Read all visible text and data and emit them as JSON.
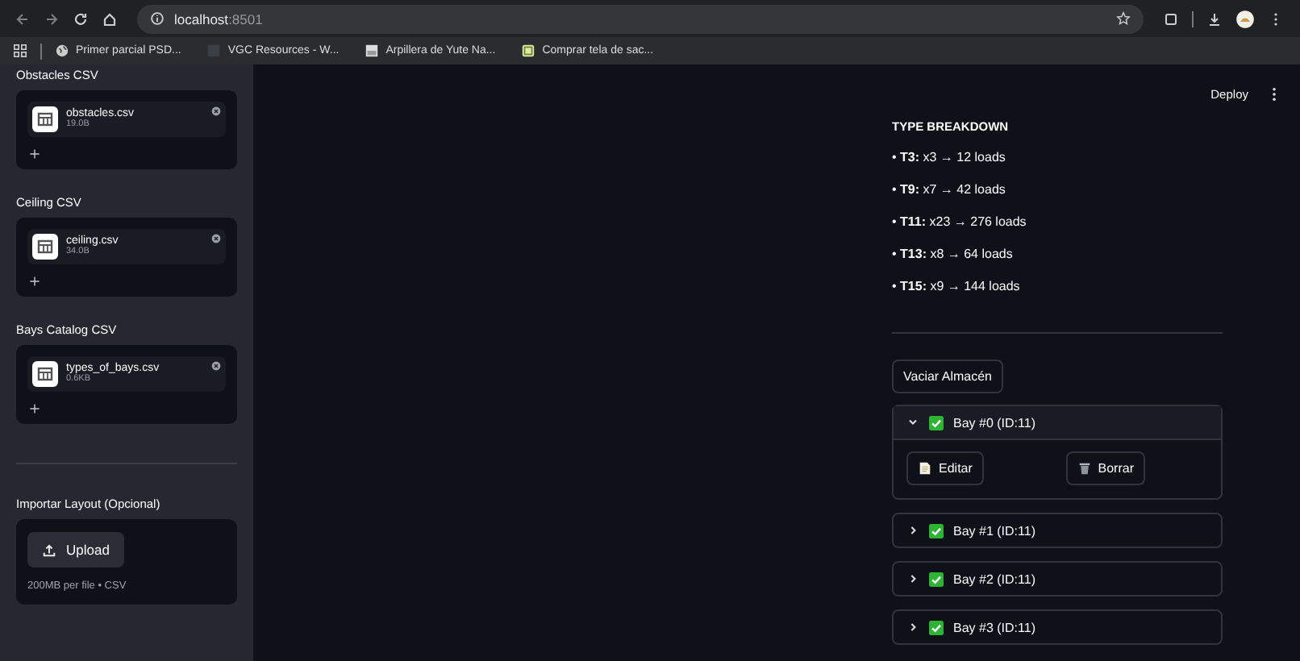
{
  "browser": {
    "url": "**localhost**:8501",
    "bookmarks": [
      {
        "label": "Primer parcial PSD...",
        "kind": "globe"
      },
      {
        "label": "VGC Resources - W...",
        "kind": "dark"
      },
      {
        "label": "Arpillera de Yute Na...",
        "kind": "image"
      },
      {
        "label": "Comprar tela de sac...",
        "kind": "leaf"
      }
    ]
  },
  "sidebar": {
    "uploaders": [
      {
        "label": "Obstacles CSV",
        "files": [
          {
            "name": "obstacles.csv",
            "size": "19.0B"
          }
        ]
      },
      {
        "label": "Ceiling CSV",
        "files": [
          {
            "name": "ceiling.csv",
            "size": "34.0B"
          }
        ]
      },
      {
        "label": "Bays Catalog CSV",
        "files": [
          {
            "name": "types_of_bays.csv",
            "size": "0.6KB"
          }
        ]
      }
    ],
    "import": {
      "label": "Importar Layout (Opcional)",
      "button": "Upload",
      "hint": "200MB per file • CSV"
    }
  },
  "toolbar": {
    "deploy": "Deploy"
  },
  "breakdown": {
    "title": "TYPE BREAKDOWN",
    "items": [
      "• **T3:** x3 → 12 loads",
      "• **T9:** x7 → 42 loads",
      "• **T11:** x23 → 276 loads",
      "• **T13:** x8 → 64 loads",
      "• **T15:** x9 → 144 loads"
    ]
  },
  "clear_button": "Vaciar Almacén",
  "bays": [
    {
      "title": "Bay #0 (ID:11)",
      "expanded": true,
      "actions": [
        {
          "kind": "edit",
          "label": "Editar"
        },
        {
          "kind": "delete",
          "label": "Borrar"
        }
      ]
    },
    {
      "title": "Bay #1 (ID:11)",
      "expanded": false
    },
    {
      "title": "Bay #2 (ID:11)",
      "expanded": false
    },
    {
      "title": "Bay #3 (ID:11)",
      "expanded": false
    }
  ]
}
